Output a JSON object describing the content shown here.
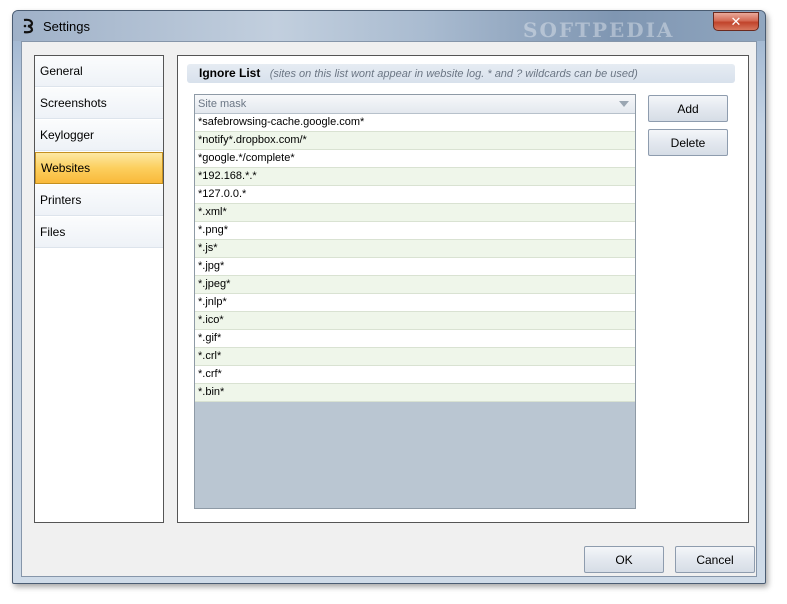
{
  "window": {
    "title": "Settings",
    "watermark": "SOFTPEDIA",
    "close_label": "✕"
  },
  "sidebar": {
    "items": [
      {
        "label": "General"
      },
      {
        "label": "Screenshots"
      },
      {
        "label": "Keylogger"
      },
      {
        "label": "Websites",
        "selected": true
      },
      {
        "label": "Printers"
      },
      {
        "label": "Files"
      }
    ]
  },
  "ignore_list": {
    "title": "Ignore List",
    "description": "(sites on this list wont appear in website log.  * and ? wildcards can be used)",
    "column_header": "Site mask",
    "rows": [
      "*safebrowsing-cache.google.com*",
      "*notify*.dropbox.com/*",
      "*google.*/complete*",
      "*192.168.*.*",
      "*127.0.0.*",
      "*.xml*",
      "*.png*",
      "*.js*",
      "*.jpg*",
      "*.jpeg*",
      "*.jnlp*",
      "*.ico*",
      "*.gif*",
      "*.crl*",
      "*.crf*",
      "*.bin*"
    ],
    "add_label": "Add",
    "delete_label": "Delete"
  },
  "footer": {
    "ok_label": "OK",
    "cancel_label": "Cancel"
  },
  "icons": {
    "app": "app-icon",
    "close": "close-icon",
    "sort": "sort-arrow-icon"
  },
  "colors": {
    "selected_item": "#fccf5e",
    "alt_row": "#eff6ea",
    "grid_empty": "#bac6d2"
  }
}
